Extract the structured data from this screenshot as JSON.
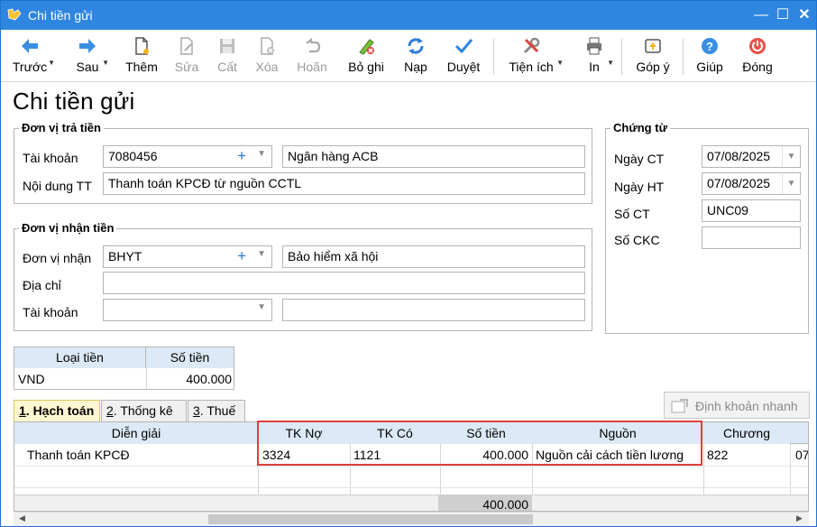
{
  "window": {
    "title": "Chi tiền gửi",
    "heading": "Chi tiền gửi"
  },
  "toolbar": {
    "buttons": [
      {
        "label": "Trước",
        "icon": "arrow-left-icon"
      },
      {
        "label": "Sau",
        "icon": "arrow-right-icon"
      },
      {
        "label": "Thêm",
        "icon": "new-document-icon"
      },
      {
        "label": "Sửa",
        "icon": "edit-document-icon"
      },
      {
        "label": "Cất",
        "icon": "save-icon"
      },
      {
        "label": "Xóa",
        "icon": "delete-document-icon"
      },
      {
        "label": "Hoãn",
        "icon": "undo-icon"
      },
      {
        "label": "Bỏ ghi",
        "icon": "unpost-icon"
      },
      {
        "label": "Nạp",
        "icon": "refresh-icon"
      },
      {
        "label": "Duyệt",
        "icon": "checkmark-icon"
      },
      {
        "label": "Tiện ích",
        "icon": "tools-icon"
      },
      {
        "label": "In",
        "icon": "printer-icon"
      },
      {
        "label": "Góp ý",
        "icon": "feedback-icon"
      },
      {
        "label": "Giúp",
        "icon": "help-icon"
      },
      {
        "label": "Đóng",
        "icon": "power-icon"
      }
    ]
  },
  "payer": {
    "legend": "Đơn vị trả tiền",
    "account_label": "Tài khoản",
    "account_value": "7080456",
    "bank_name": "Ngân hàng ACB",
    "content_label": "Nội dung TT",
    "content_value": "Thanh toán KPCĐ từ nguồn CCTL"
  },
  "payee": {
    "legend": "Đơn vị nhận tiền",
    "unit_label": "Đơn vị nhận",
    "unit_value": "BHYT",
    "unit_name": "Bảo hiểm xã hội",
    "address_label": "Địa chỉ",
    "address_value": "",
    "account_label": "Tài khoản",
    "account_value": "",
    "account_extra": ""
  },
  "voucher": {
    "legend": "Chứng từ",
    "date_ct_label": "Ngày CT",
    "date_ct_value": "07/08/2025",
    "date_ht_label": "Ngày HT",
    "date_ht_value": "07/08/2025",
    "no_ct_label": "Số CT",
    "no_ct_value": "UNC09",
    "no_ckc_label": "Số CKC",
    "no_ckc_value": ""
  },
  "currency": {
    "headers": [
      "Loại tiền",
      "Số tiền"
    ],
    "row": [
      "VND",
      "400.000"
    ]
  },
  "tabs": [
    {
      "key": "1",
      "label": ". Hạch toán"
    },
    {
      "key": "2",
      "label": ". Thống kê"
    },
    {
      "key": "3",
      "label": ". Thuế"
    }
  ],
  "quick_entry_label": "Định khoản nhanh",
  "grid": {
    "headers": [
      "Diễn giải",
      "TK Nợ",
      "TK Có",
      "Số tiền",
      "Nguồn",
      "Chương"
    ],
    "rows": [
      {
        "desc": "Thanh toán KPCĐ",
        "debit": "3324",
        "credit": "1121",
        "amount": "400.000",
        "source": "Nguồn cải cách tiền lương",
        "chapter": "822",
        "extra": "07"
      }
    ],
    "total": "400.000"
  }
}
